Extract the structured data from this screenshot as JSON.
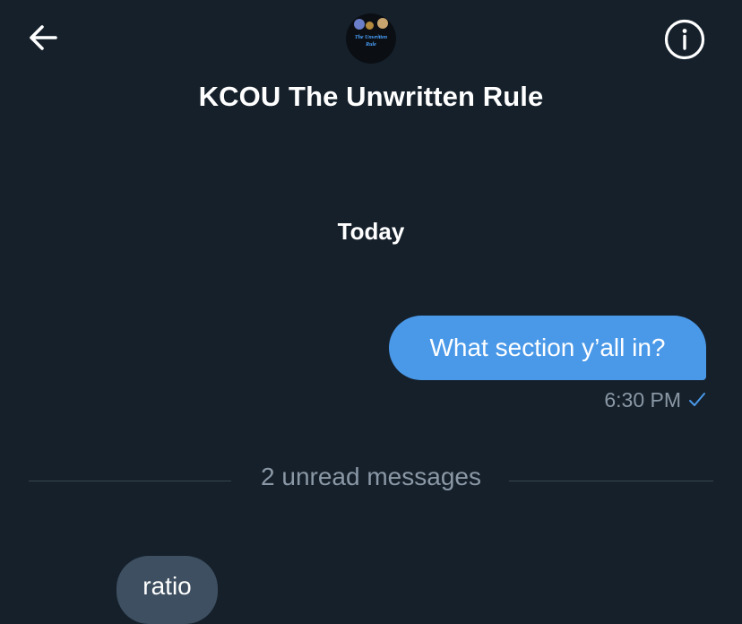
{
  "header": {
    "title": "KCOU The Unwritten Rule",
    "back_icon": "arrow-left-icon",
    "info_icon": "info-circle-icon",
    "avatar": {
      "line1": "The Unwritten",
      "line2": "Rule"
    }
  },
  "conversation": {
    "day_label": "Today",
    "outgoing": {
      "text": "What section y’all in?",
      "time": "6:30 PM",
      "status_icon": "checkmark-icon"
    },
    "unread_divider": "2 unread messages",
    "incoming": {
      "text": "ratio"
    }
  },
  "colors": {
    "background": "#15202b",
    "outgoing_bubble": "#4a99e9",
    "incoming_bubble": "#3d4f60",
    "muted_text": "#8b98a5",
    "divider": "#38444d"
  }
}
